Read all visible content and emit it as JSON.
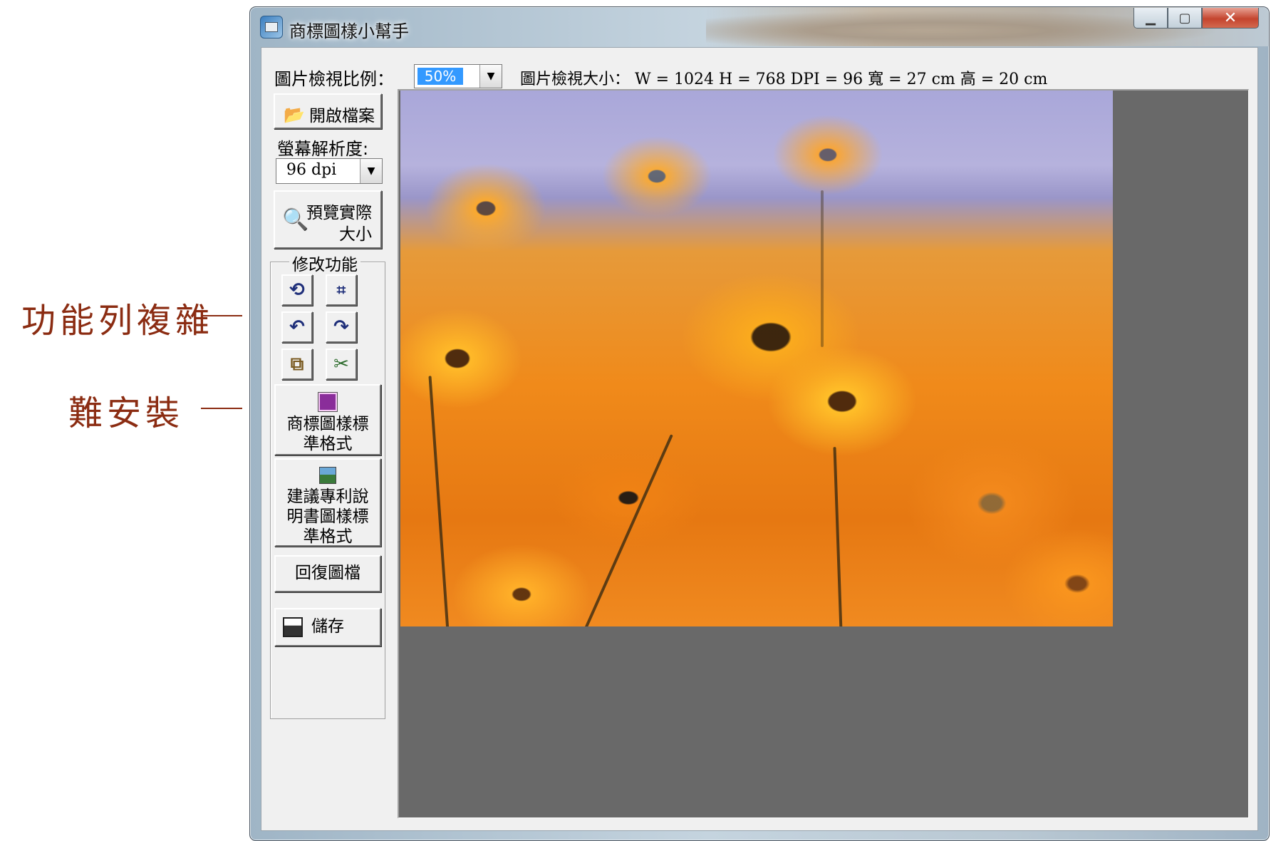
{
  "annotations": {
    "line1": "功能列複雜",
    "line2": "難安裝"
  },
  "window": {
    "title": "商標圖樣小幫手",
    "controls": {
      "minimize": "▁",
      "maximize": "▢",
      "close": "✕"
    }
  },
  "topbar": {
    "zoom_label": "圖片檢視比例：",
    "zoom_value": "50%",
    "size_label": "圖片檢視大小：",
    "size_info": "W = 1024  H = 768  DPI = 96 寬 = 27 cm  高 = 20 cm"
  },
  "sidebar": {
    "open_file": "開啟檔案",
    "dpi_label": "螢幕解析度:",
    "dpi_value": "96 dpi",
    "preview_line1": "預覽實際",
    "preview_line2": "大小",
    "edit_group_title": "修改功能",
    "tool_icons": [
      "rotate-left-icon",
      "crop-icon",
      "undo-icon",
      "redo-icon",
      "resize-icon",
      "scissors-icon"
    ],
    "trademark_btn": [
      "商標圖樣標",
      "準格式"
    ],
    "patent_btn": [
      "建議專利說",
      "明書圖樣標",
      "準格式"
    ],
    "restore_btn": "回復圖檔",
    "save_btn": "儲存"
  },
  "colors": {
    "annotation": "#8b2c12",
    "canvas_bg": "#696969",
    "selection": "#3399ff"
  }
}
